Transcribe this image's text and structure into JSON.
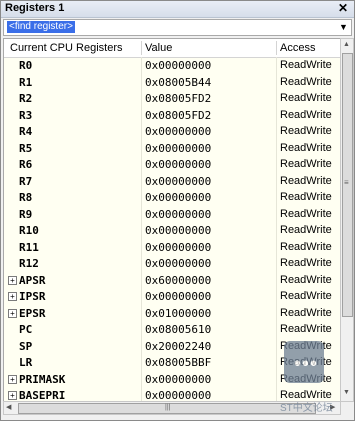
{
  "window": {
    "title": "Registers 1",
    "close_glyph": "✕"
  },
  "find": {
    "placeholder": "<find register>"
  },
  "table": {
    "headers": {
      "name": "Current CPU Registers",
      "value": "Value",
      "access": "Access"
    },
    "rows": [
      {
        "name": "R0",
        "value": "0x00000000",
        "access": "ReadWrite",
        "expandable": false
      },
      {
        "name": "R1",
        "value": "0x08005B44",
        "access": "ReadWrite",
        "expandable": false
      },
      {
        "name": "R2",
        "value": "0x08005FD2",
        "access": "ReadWrite",
        "expandable": false
      },
      {
        "name": "R3",
        "value": "0x08005FD2",
        "access": "ReadWrite",
        "expandable": false
      },
      {
        "name": "R4",
        "value": "0x00000000",
        "access": "ReadWrite",
        "expandable": false
      },
      {
        "name": "R5",
        "value": "0x00000000",
        "access": "ReadWrite",
        "expandable": false
      },
      {
        "name": "R6",
        "value": "0x00000000",
        "access": "ReadWrite",
        "expandable": false
      },
      {
        "name": "R7",
        "value": "0x00000000",
        "access": "ReadWrite",
        "expandable": false
      },
      {
        "name": "R8",
        "value": "0x00000000",
        "access": "ReadWrite",
        "expandable": false
      },
      {
        "name": "R9",
        "value": "0x00000000",
        "access": "ReadWrite",
        "expandable": false
      },
      {
        "name": "R10",
        "value": "0x00000000",
        "access": "ReadWrite",
        "expandable": false
      },
      {
        "name": "R11",
        "value": "0x00000000",
        "access": "ReadWrite",
        "expandable": false
      },
      {
        "name": "R12",
        "value": "0x00000000",
        "access": "ReadWrite",
        "expandable": false
      },
      {
        "name": "APSR",
        "value": "0x60000000",
        "access": "ReadWrite",
        "expandable": true
      },
      {
        "name": "IPSR",
        "value": "0x00000000",
        "access": "ReadWrite",
        "expandable": true
      },
      {
        "name": "EPSR",
        "value": "0x01000000",
        "access": "ReadWrite",
        "expandable": true
      },
      {
        "name": "PC",
        "value": "0x08005610",
        "access": "ReadWrite",
        "expandable": false
      },
      {
        "name": "SP",
        "value": "0x20002240",
        "access": "ReadWrite",
        "expandable": false
      },
      {
        "name": "LR",
        "value": "0x08005BBF",
        "access": "ReadWrite",
        "expandable": false
      },
      {
        "name": "PRIMASK",
        "value": "0x00000000",
        "access": "ReadWrite",
        "expandable": true
      },
      {
        "name": "BASEPRI",
        "value": "0x00000000",
        "access": "ReadWrite",
        "expandable": true
      }
    ]
  },
  "scroll": {
    "up": "▲",
    "down": "▼",
    "left": "◀",
    "right": "▶",
    "grip": "|||",
    "thumb_grip": "≡"
  },
  "watermark": {
    "dots": "•••",
    "text": "ST中文论坛"
  },
  "expand_glyph": "+"
}
